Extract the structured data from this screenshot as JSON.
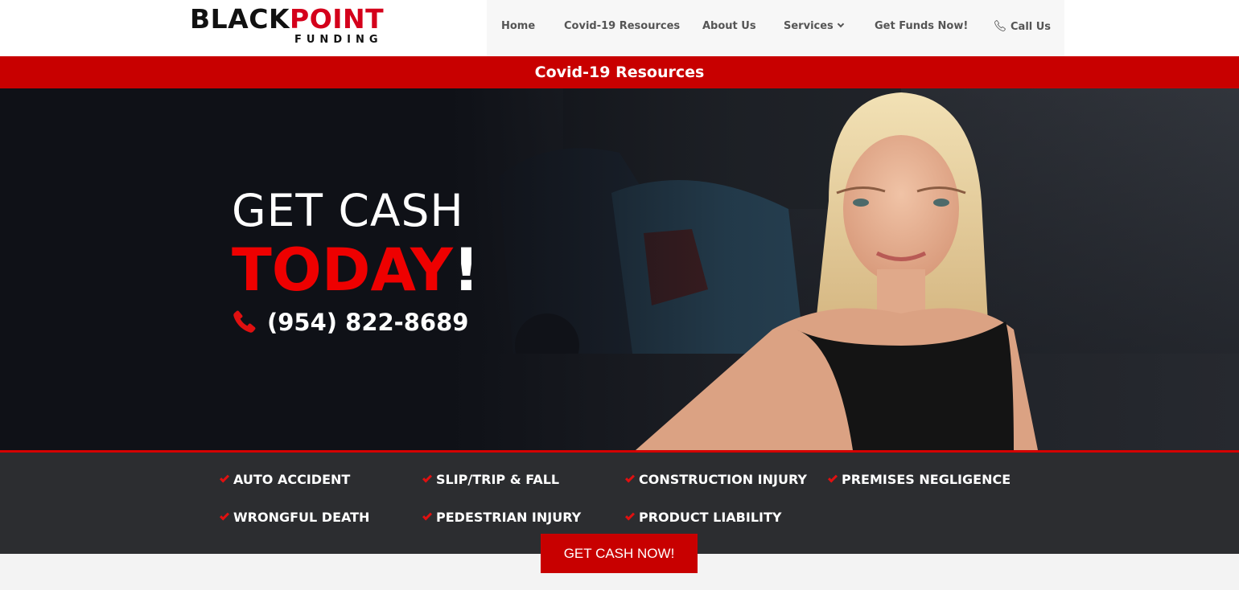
{
  "logo": {
    "main_black": "BLACK",
    "main_red": "POINT",
    "sub": "FUNDING"
  },
  "nav": {
    "items": [
      {
        "label": "Home"
      },
      {
        "label": "Covid-19 Resources"
      },
      {
        "label": "About Us"
      },
      {
        "label": "Services"
      },
      {
        "label": "Get Funds Now!"
      },
      {
        "label": "Call Us"
      }
    ]
  },
  "banner": {
    "label": "Covid-19 Resources"
  },
  "hero": {
    "line1": "GET CASH",
    "line2_red": "TODAY",
    "line2_punct": "!",
    "phone": "(954) 822-8689"
  },
  "services": [
    "AUTO ACCIDENT",
    "SLIP/TRIP & FALL",
    "CONSTRUCTION INJURY",
    "PREMISES NEGLIGENCE",
    "WRONGFUL DEATH",
    "PEDESTRIAN INJURY",
    "PRODUCT LIABILITY"
  ],
  "cta": {
    "label": "GET CASH NOW!"
  },
  "colors": {
    "brand_red": "#c80000",
    "accent_red": "#ee0000",
    "dark": "#0f1117",
    "strip": "#2c2d30"
  }
}
